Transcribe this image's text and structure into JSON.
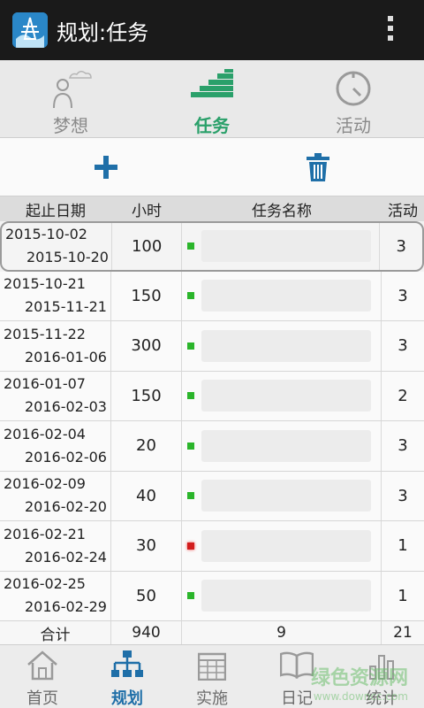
{
  "app": {
    "title": "规划:任务"
  },
  "top_tabs": [
    {
      "label": "梦想",
      "icon": "person-cloud-icon",
      "active": false
    },
    {
      "label": "任务",
      "icon": "stairs-icon",
      "active": true
    },
    {
      "label": "活动",
      "icon": "stopwatch-icon",
      "active": false
    }
  ],
  "toolbar": {
    "add_icon": "plus-icon",
    "delete_icon": "trash-icon"
  },
  "table": {
    "headers": [
      "起止日期",
      "小时",
      "任务名称",
      "活动"
    ],
    "rows": [
      {
        "start": "2015-10-02",
        "end": "2015-10-20",
        "hours": "100",
        "activities": "3",
        "status": "green"
      },
      {
        "start": "2015-10-21",
        "end": "2015-11-21",
        "hours": "150",
        "activities": "3",
        "status": "green"
      },
      {
        "start": "2015-11-22",
        "end": "2016-01-06",
        "hours": "300",
        "activities": "3",
        "status": "green"
      },
      {
        "start": "2016-01-07",
        "end": "2016-02-03",
        "hours": "150",
        "activities": "2",
        "status": "green"
      },
      {
        "start": "2016-02-04",
        "end": "2016-02-06",
        "hours": "20",
        "activities": "3",
        "status": "green"
      },
      {
        "start": "2016-02-09",
        "end": "2016-02-20",
        "hours": "40",
        "activities": "3",
        "status": "green"
      },
      {
        "start": "2016-02-21",
        "end": "2016-02-24",
        "hours": "30",
        "activities": "1",
        "status": "red"
      },
      {
        "start": "2016-02-25",
        "end": "2016-02-29",
        "hours": "50",
        "activities": "1",
        "status": "green"
      }
    ],
    "totals": {
      "label": "合计",
      "hours": "940",
      "tasks": "9",
      "activities": "21"
    }
  },
  "bottom_nav": [
    {
      "label": "首页",
      "icon": "home-icon",
      "active": false
    },
    {
      "label": "规划",
      "icon": "org-chart-icon",
      "active": true
    },
    {
      "label": "实施",
      "icon": "calendar-icon",
      "active": false
    },
    {
      "label": "日记",
      "icon": "book-icon",
      "active": false
    },
    {
      "label": "统计",
      "icon": "bar-chart-icon",
      "active": false
    }
  ],
  "watermark": {
    "line1": "绿色资源网",
    "line2": "www.downcc.com"
  },
  "colors": {
    "accent_green": "#2aa06a",
    "accent_blue": "#1f6fa8",
    "status_green": "#2bb52b",
    "status_red": "#d21c1c"
  }
}
